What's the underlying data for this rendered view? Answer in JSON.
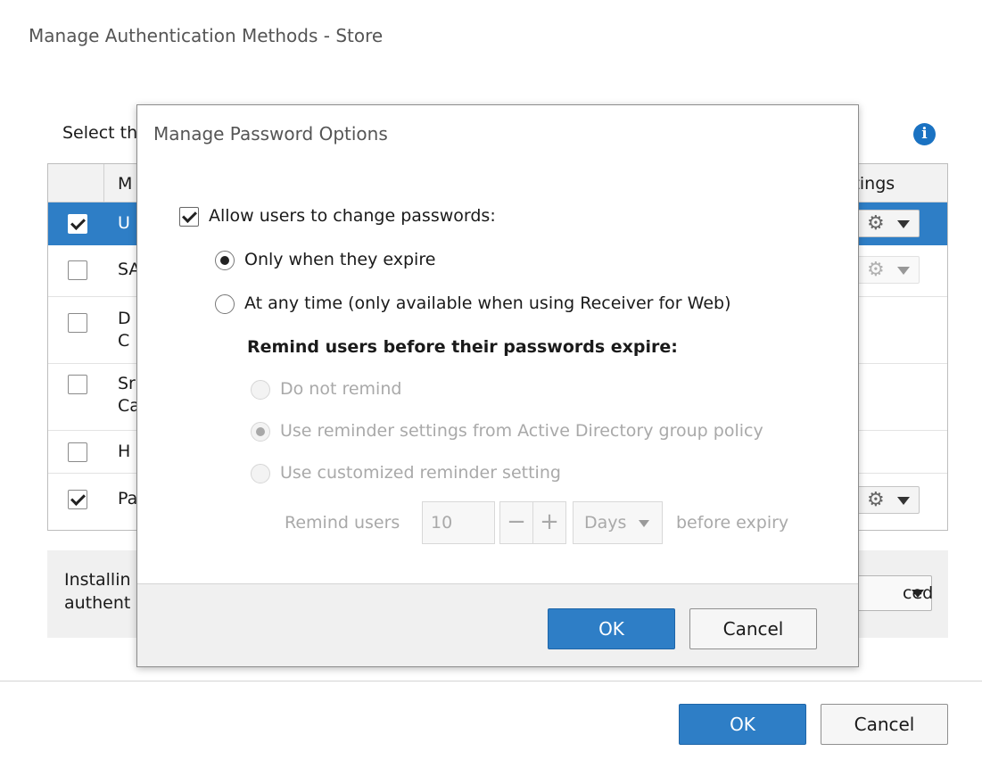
{
  "background_window": {
    "title": "Manage Authentication Methods - Store",
    "instruction_visible": "Select the",
    "info_icon": "info-icon",
    "table": {
      "header_method_visible": "M",
      "header_settings_visible": "ttings",
      "rows": [
        {
          "text_visible": "U",
          "checked": true,
          "selected": true,
          "has_settings": true,
          "settings_enabled": true
        },
        {
          "text_visible": "SA",
          "checked": false,
          "selected": false,
          "has_settings": true,
          "settings_enabled": false
        },
        {
          "text_visible": "D",
          "text_line2_visible": "C",
          "checked": false,
          "selected": false,
          "has_settings": false
        },
        {
          "text_visible": "Sr",
          "text_line2_visible": "Ca",
          "checked": false,
          "selected": false,
          "has_settings": false
        },
        {
          "text_visible": "H",
          "checked": false,
          "selected": false,
          "has_settings": false
        },
        {
          "text_visible": "Pa",
          "checked": true,
          "selected": false,
          "has_settings": true,
          "settings_enabled": true
        }
      ]
    },
    "footer_text_line1_visible": "Installin",
    "footer_text_line2_visible": "authent",
    "advanced_button_visible": "ced",
    "ok_label": "OK",
    "cancel_label": "Cancel"
  },
  "dialog": {
    "title": "Manage Password Options",
    "allow_change_label": "Allow users to change passwords:",
    "allow_change_checked": true,
    "option_expire_label": "Only when they expire",
    "option_anytime_label": "At any time (only available when using Receiver for Web)",
    "selected_option": "expire",
    "remind_heading": "Remind users before their passwords expire:",
    "remind_options": [
      {
        "label": "Do not remind",
        "checked": false
      },
      {
        "label": "Use reminder settings from Active Directory group policy",
        "checked": true
      },
      {
        "label": "Use customized reminder setting",
        "checked": false
      }
    ],
    "remind_users_label": "Remind users",
    "remind_value": "10",
    "decrement_label": "−",
    "increment_label": "+",
    "unit_value": "Days",
    "before_expiry_label": "before expiry",
    "ok_label": "OK",
    "cancel_label": "Cancel"
  },
  "colors": {
    "accent": "#2e7ec6",
    "disabled_text": "#a9a9a9",
    "info_icon": "#1a72c2"
  }
}
